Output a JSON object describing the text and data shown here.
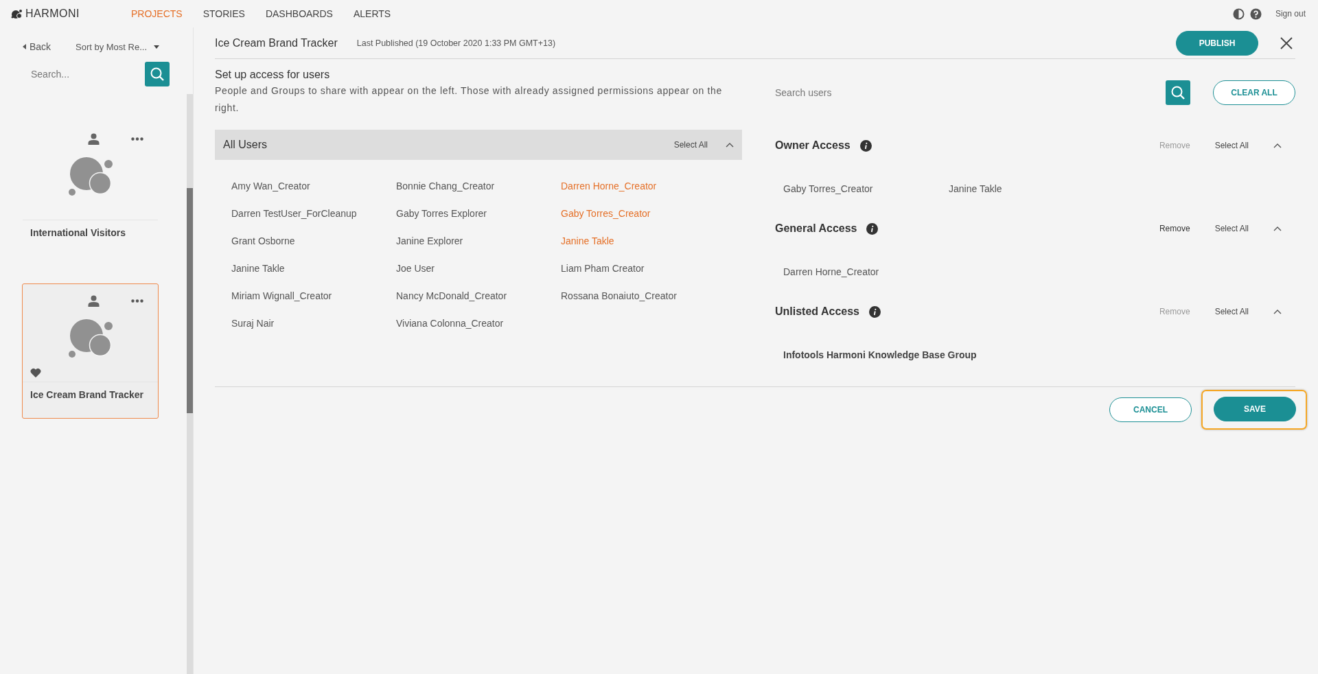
{
  "app": {
    "logo": "HARMONI"
  },
  "nav": [
    {
      "label": "PROJECTS",
      "selected": true
    },
    {
      "label": "STORIES",
      "selected": false
    },
    {
      "label": "DASHBOARDS",
      "selected": false
    },
    {
      "label": "ALERTS",
      "selected": false
    }
  ],
  "header_tools": {
    "sign_out": "Sign out"
  },
  "sidebar": {
    "back": "Back",
    "sort": "Sort by Most Re...",
    "search_placeholder": "Search...",
    "projects": [
      {
        "title": "International Visitors",
        "selected": false,
        "favorite": false
      },
      {
        "title": "Ice Cream Brand Tracker",
        "selected": true,
        "favorite": true
      }
    ]
  },
  "editor": {
    "title": "Ice Cream Brand Tracker",
    "last_published": "Last Published (19 October 2020 1:33 PM GMT+13)",
    "publish": "PUBLISH"
  },
  "access": {
    "heading": "Set up access for users",
    "description": "People and Groups to share with appear on the left. Those with already assigned permissions appear on the right.",
    "all_users": {
      "title": "All Users",
      "select_all": "Select All",
      "expanded": true,
      "users": [
        {
          "name": "Amy Wan_Creator",
          "assigned": false
        },
        {
          "name": "Bonnie Chang_Creator",
          "assigned": false
        },
        {
          "name": "Darren Horne_Creator",
          "assigned": true
        },
        {
          "name": "Darren TestUser_ForCleanup",
          "assigned": false
        },
        {
          "name": "Gaby Torres Explorer",
          "assigned": false
        },
        {
          "name": "Gaby Torres_Creator",
          "assigned": true
        },
        {
          "name": "Grant Osborne",
          "assigned": false
        },
        {
          "name": "Janine Explorer",
          "assigned": false
        },
        {
          "name": "Janine Takle",
          "assigned": true
        },
        {
          "name": "Janine Takle",
          "assigned": false
        },
        {
          "name": "Joe User",
          "assigned": false
        },
        {
          "name": "Liam Pham Creator",
          "assigned": false
        },
        {
          "name": "Miriam Wignall_Creator",
          "assigned": false
        },
        {
          "name": "Nancy McDonald_Creator",
          "assigned": false
        },
        {
          "name": "Rossana Bonaiuto_Creator",
          "assigned": false
        },
        {
          "name": "Suraj Nair",
          "assigned": false
        },
        {
          "name": "Viviana Colonna_Creator",
          "assigned": false
        }
      ]
    },
    "search_placeholder": "Search users",
    "clear_all": "CLEAR ALL",
    "groups": [
      {
        "title": "Owner Access",
        "remove": "Remove",
        "remove_disabled": true,
        "select_all": "Select All",
        "expanded": true,
        "members": [
          {
            "name": "Gaby Torres_Creator",
            "kind": "user"
          },
          {
            "name": "Janine Takle",
            "kind": "user"
          }
        ]
      },
      {
        "title": "General Access",
        "remove": "Remove",
        "remove_disabled": false,
        "select_all": "Select All",
        "expanded": true,
        "members": [
          {
            "name": "Darren Horne_Creator",
            "kind": "user"
          }
        ]
      },
      {
        "title": "Unlisted Access",
        "remove": "Remove",
        "remove_disabled": true,
        "select_all": "Select All",
        "expanded": true,
        "members": [
          {
            "name": "Infotools Harmoni Knowledge Base Group",
            "kind": "group"
          }
        ]
      }
    ]
  },
  "actions": {
    "cancel": "CANCEL",
    "save": "SAVE",
    "save_highlighted": true
  }
}
